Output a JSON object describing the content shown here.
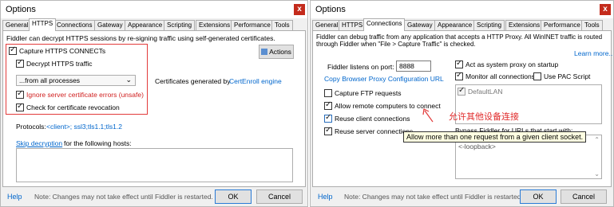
{
  "left": {
    "title": "Options",
    "close_glyph": "x",
    "tabs": [
      "General",
      "HTTPS",
      "Connections",
      "Gateway",
      "Appearance",
      "Scripting",
      "Extensions",
      "Performance",
      "Tools"
    ],
    "active_tab": "HTTPS",
    "intro": "Fiddler can decrypt HTTPS sessions by re-signing traffic using self-generated certificates.",
    "capture_connects": "Capture HTTPS CONNECTs",
    "actions": "Actions",
    "decrypt": "Decrypt HTTPS traffic",
    "process_select": "...from all processes",
    "cert_text": "Certificates generated by",
    "cert_link": "CertEnroll engine",
    "ignore_errors": "Ignore server certificate errors (unsafe)",
    "revocation": "Check for certificate revocation",
    "protocols_label": "Protocols:",
    "protocols_value": "<client>; ssl3;tls1.1;tls1.2",
    "skip_link": "Skip decryption",
    "skip_rest": "for the following hosts:",
    "help": "Help",
    "note": "Note: Changes may not take effect until Fiddler is restarted.",
    "ok": "OK",
    "cancel": "Cancel"
  },
  "right": {
    "title": "Options",
    "close_glyph": "x",
    "tabs": [
      "General",
      "HTTPS",
      "Connections",
      "Gateway",
      "Appearance",
      "Scripting",
      "Extensions",
      "Performance",
      "Tools"
    ],
    "active_tab": "Connections",
    "intro1": "Fiddler can debug traffic from any application that accepts a HTTP Proxy. All WinINET traffic is routed",
    "intro2": "through Fiddler when \"File > Capture Traffic\" is checked.",
    "learn_more": "Learn more...",
    "port_label": "Fiddler listens on port:",
    "port_value": "8888",
    "copy_link": "Copy Browser Proxy Configuration URL",
    "capture_ftp": "Capture FTP requests",
    "allow_remote": "Allow remote computers to connect",
    "reuse_client": "Reuse client connections",
    "reuse_server": "Reuse server connections",
    "system_proxy": "Act as system proxy on startup",
    "monitor_all": "Monitor all connections",
    "use_pac": "Use PAC Script",
    "default_lan": "DefaultLAN",
    "bypass": "Bypass Fiddler for URLs that start with:",
    "bypass_value": "<-loopback>",
    "annotation": "允许其他设备连接",
    "tooltip": "Allow more than one request from a given client socket.",
    "help": "Help",
    "note": "Note: Changes may not take effect until Fiddler is restarted.",
    "ok": "OK",
    "cancel": "Cancel"
  },
  "colors": {
    "accent_red": "#e23b3b",
    "link_blue": "#0066cc",
    "tooltip_bg": "#ffffe1"
  }
}
